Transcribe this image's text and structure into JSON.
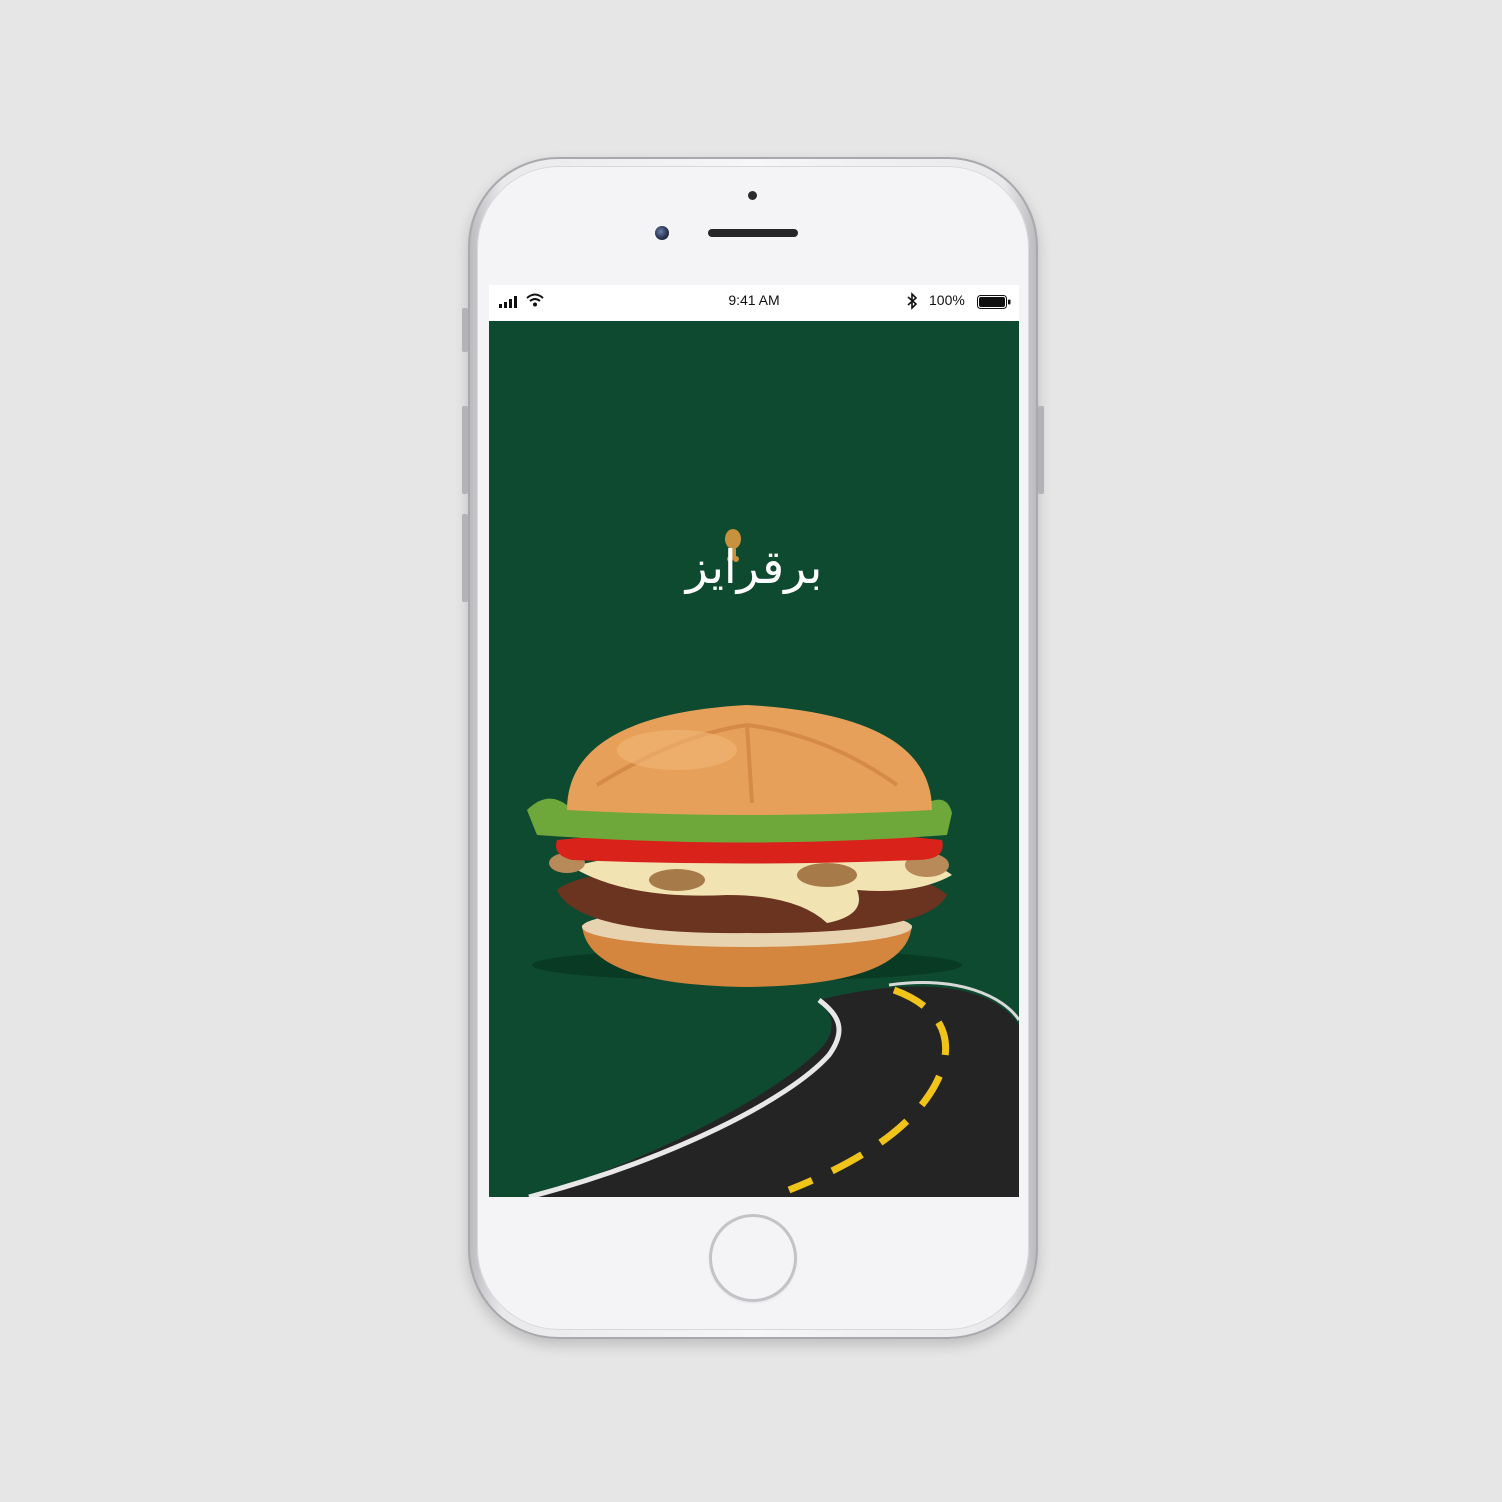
{
  "status_bar": {
    "time": "9:41 AM",
    "battery_percent": "100%",
    "signal_icon": "cellular-signal-icon",
    "wifi_icon": "wifi-icon",
    "bluetooth_icon": "bluetooth-icon",
    "battery_icon": "battery-icon",
    "battery_level": 1.0
  },
  "splash": {
    "brand_name": "برقرايز",
    "background_color": "#0e4a30",
    "logo_accent_color": "#c8913e",
    "logo_icon": "drumstick-icon",
    "hero_image": "burger-image",
    "decoration": "road-image"
  },
  "device": {
    "model": "iPhone",
    "home_button_icon": "home-button"
  }
}
